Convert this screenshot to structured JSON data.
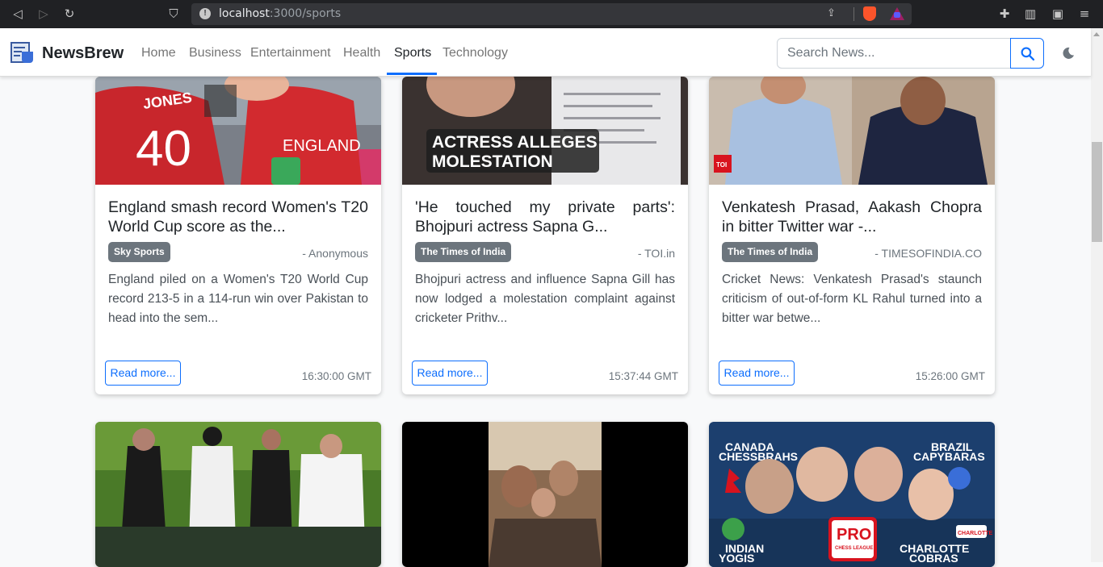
{
  "browser": {
    "url_host": "localhost",
    "url_path": ":3000/sports"
  },
  "navbar": {
    "brand": "NewsBrew",
    "links": [
      "Home",
      "Business",
      "Entertainment",
      "Health",
      "Sports",
      "Technology"
    ],
    "active": "Sports",
    "search_placeholder": "Search News..."
  },
  "cards": [
    {
      "title": "England smash record Women's T20 World Cup score as the...",
      "source": "Sky Sports",
      "author": "- Anonymous",
      "description": "England piled on a Women's T20 World Cup record 213-5 in a 114-run win over Pakistan to head into the sem...",
      "button": "Read more...",
      "time": "16:30:00 GMT",
      "image_text": [
        "JONES",
        "40",
        "ENGLAND"
      ]
    },
    {
      "title": "'He touched my private parts': Bhojpuri actress Sapna G...",
      "source": "The Times of India",
      "author": "- TOI.in",
      "description": "Bhojpuri actress and influence Sapna Gill has now lodged a molestation complaint against cricketer Prithv...",
      "button": "Read more...",
      "time": "15:37:44 GMT",
      "image_text": [
        "ACTRESS ALLEGES",
        "MOLESTATION"
      ]
    },
    {
      "title": "Venkatesh Prasad, Aakash Chopra in bitter Twitter war -...",
      "source": "The Times of India",
      "author": "- TIMESOFINDIA.CO",
      "description": "Cricket News: Venkatesh Prasad's staunch criticism of out-of-form KL Rahul turned into a bitter war betwe...",
      "button": "Read more...",
      "time": "15:26:00 GMT",
      "image_text": [
        "TOI"
      ]
    }
  ],
  "row2_images": [
    {
      "image_text": []
    },
    {
      "image_text": []
    },
    {
      "image_text": [
        "CANADA",
        "CHESSBRAHS",
        "BRAZIL",
        "CAPYBARAS",
        "INDIAN",
        "YOGIS",
        "PRO",
        "CHESS LEAGUE",
        "CHARLOTTE",
        "COBRAS",
        "CHARLOTTE"
      ]
    }
  ]
}
